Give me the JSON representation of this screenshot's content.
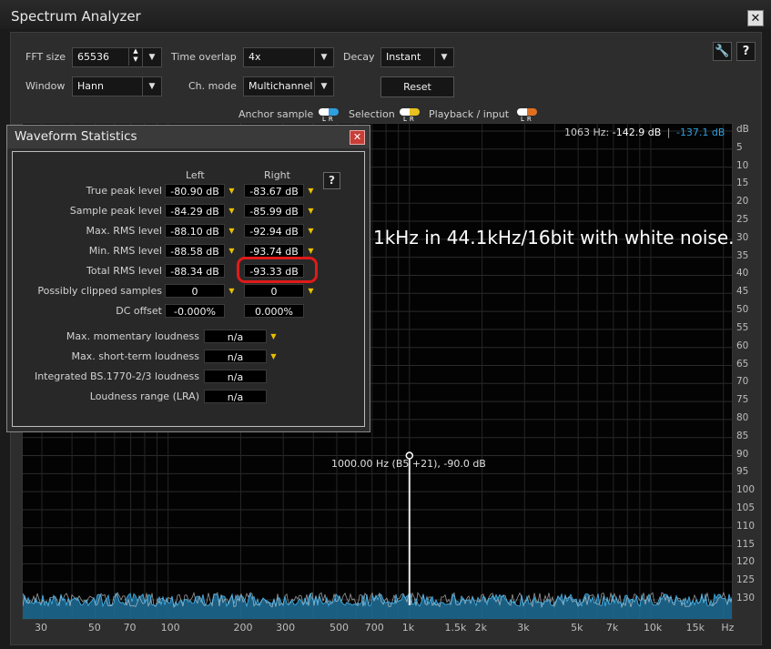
{
  "window": {
    "title": "Spectrum Analyzer",
    "close_glyph": "✕"
  },
  "controls": {
    "fft_size_label": "FFT size",
    "fft_size_value": "65536",
    "time_overlap_label": "Time overlap",
    "time_overlap_value": "4x",
    "decay_label": "Decay",
    "decay_value": "Instant",
    "window_label": "Window",
    "window_value": "Hann",
    "ch_mode_label": "Ch. mode",
    "ch_mode_value": "Multichannel",
    "reset_label": "Reset",
    "help_glyph": "?"
  },
  "legend": {
    "anchor_label": "Anchor sample",
    "selection_label": "Selection",
    "playback_label": "Playback / input",
    "lr_text": "LR",
    "colors": {
      "anchor_l": "#ffffff",
      "anchor_r": "#2f9fe0",
      "selection_l": "#ffffff",
      "selection_r": "#e8c020",
      "playback_l": "#ffffff",
      "playback_r": "#e07020"
    }
  },
  "readout": {
    "freq": "1063 Hz:",
    "left_db": "-142.9 dB",
    "sep": "|",
    "right_db": "-137.1 dB"
  },
  "annotation": "1kHz in 44.1kHz/16bit with white noise.",
  "peak_marker": {
    "label": "1000.00 Hz (B5 +21), -90.0 dB",
    "freq_hz": 1000,
    "db": -90.0
  },
  "chart_data": {
    "type": "line",
    "x_scale": "log",
    "xlim": [
      25,
      22050
    ],
    "ylim": [
      -133,
      0
    ],
    "y_ticks": [
      "dB",
      "5",
      "10",
      "15",
      "20",
      "25",
      "30",
      "35",
      "40",
      "45",
      "50",
      "55",
      "60",
      "65",
      "70",
      "75",
      "80",
      "85",
      "90",
      "95",
      "100",
      "105",
      "110",
      "115",
      "120",
      "125",
      "130"
    ],
    "x_ticks": [
      {
        "label": "30",
        "hz": 30
      },
      {
        "label": "50",
        "hz": 50
      },
      {
        "label": "70",
        "hz": 70
      },
      {
        "label": "100",
        "hz": 100
      },
      {
        "label": "200",
        "hz": 200
      },
      {
        "label": "300",
        "hz": 300
      },
      {
        "label": "500",
        "hz": 500
      },
      {
        "label": "700",
        "hz": 700
      },
      {
        "label": "1k",
        "hz": 1000
      },
      {
        "label": "1.5k",
        "hz": 1500
      },
      {
        "label": "2k",
        "hz": 2000
      },
      {
        "label": "3k",
        "hz": 3000
      },
      {
        "label": "5k",
        "hz": 5000
      },
      {
        "label": "7k",
        "hz": 7000
      },
      {
        "label": "10k",
        "hz": 10000
      },
      {
        "label": "15k",
        "hz": 15000
      },
      {
        "label": "Hz",
        "hz": 21000
      }
    ],
    "noise_floor_db": -130,
    "peaks": [
      {
        "hz": 1000,
        "db": -90.0
      }
    ],
    "grid": true
  },
  "stats": {
    "title": "Waveform Statistics",
    "close_glyph": "✕",
    "help_glyph": "?",
    "pin_glyph": "▼",
    "left_header": "Left",
    "right_header": "Right",
    "rows": [
      {
        "label": "True peak level",
        "left": "-80.90 dB",
        "right": "-83.67 dB"
      },
      {
        "label": "Sample peak level",
        "left": "-84.29 dB",
        "right": "-85.99 dB"
      },
      {
        "label": "Max. RMS level",
        "left": "-88.10 dB",
        "right": "-92.94 dB"
      },
      {
        "label": "Min. RMS level",
        "left": "-88.58 dB",
        "right": "-93.74 dB"
      },
      {
        "label": "Total RMS level",
        "left": "-88.34 dB",
        "right": "-93.33 dB"
      },
      {
        "label": "Possibly clipped samples",
        "left": "0",
        "right": "0"
      },
      {
        "label": "DC offset",
        "left": "-0.000%",
        "right": "0.000%"
      }
    ],
    "loudness": [
      {
        "label": "Max. momentary loudness",
        "value": "n/a"
      },
      {
        "label": "Max. short-term loudness",
        "value": "n/a"
      },
      {
        "label": "Integrated BS.1770-2/3 loudness",
        "value": "n/a"
      },
      {
        "label": "Loudness range (LRA)",
        "value": "n/a"
      }
    ]
  }
}
